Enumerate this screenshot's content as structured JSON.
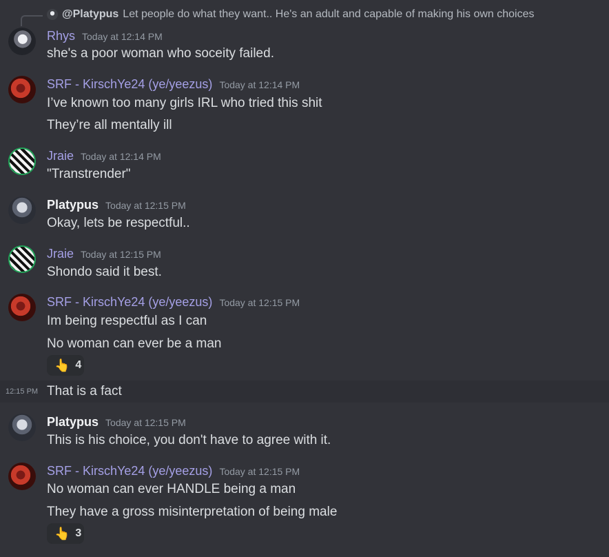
{
  "reply": {
    "author": "@Platypus",
    "text": "Let people do what they want.. He's an adult and capable of making his own choices"
  },
  "messages": [
    {
      "author": "Rhys",
      "time": "Today at 12:14 PM",
      "lines": [
        "she's a poor woman who soceity failed."
      ]
    },
    {
      "author": "SRF - KirschYe24 (ye/yeezus)",
      "time": "Today at 12:14 PM",
      "lines": [
        "I’ve known too many girls IRL who tried this shit",
        "They’re all mentally ill"
      ]
    },
    {
      "author": "Jraie",
      "time": "Today at 12:14 PM",
      "lines": [
        "\"Transtrender\""
      ]
    },
    {
      "author": "Platypus",
      "time": "Today at 12:15 PM",
      "lines": [
        "Okay, lets be respectful.."
      ]
    },
    {
      "author": "Jraie",
      "time": "Today at 12:15 PM",
      "lines": [
        "Shondo said it best."
      ]
    },
    {
      "author": "SRF - KirschYe24 (ye/yeezus)",
      "time": "Today at 12:15 PM",
      "lines": [
        "Im being respectful as I can",
        "No woman can ever be a man"
      ],
      "reaction": {
        "emoji": "👆",
        "count": "4"
      },
      "followup": {
        "time": "12:15 PM",
        "text": "That is a fact"
      }
    },
    {
      "author": "Platypus",
      "time": "Today at 12:15 PM",
      "lines": [
        "This is his choice, you don't have to agree with it."
      ]
    },
    {
      "author": "SRF - KirschYe24 (ye/yeezus)",
      "time": "Today at 12:15 PM",
      "lines": [
        "No woman can ever HANDLE being a man",
        "They have a gross misinterpretation of being male"
      ],
      "reaction": {
        "emoji": "👆",
        "count": "3"
      }
    }
  ],
  "colors": {
    "background": "#323339",
    "role_purple": "#a5a0e6",
    "timestamp": "#949ba4"
  }
}
